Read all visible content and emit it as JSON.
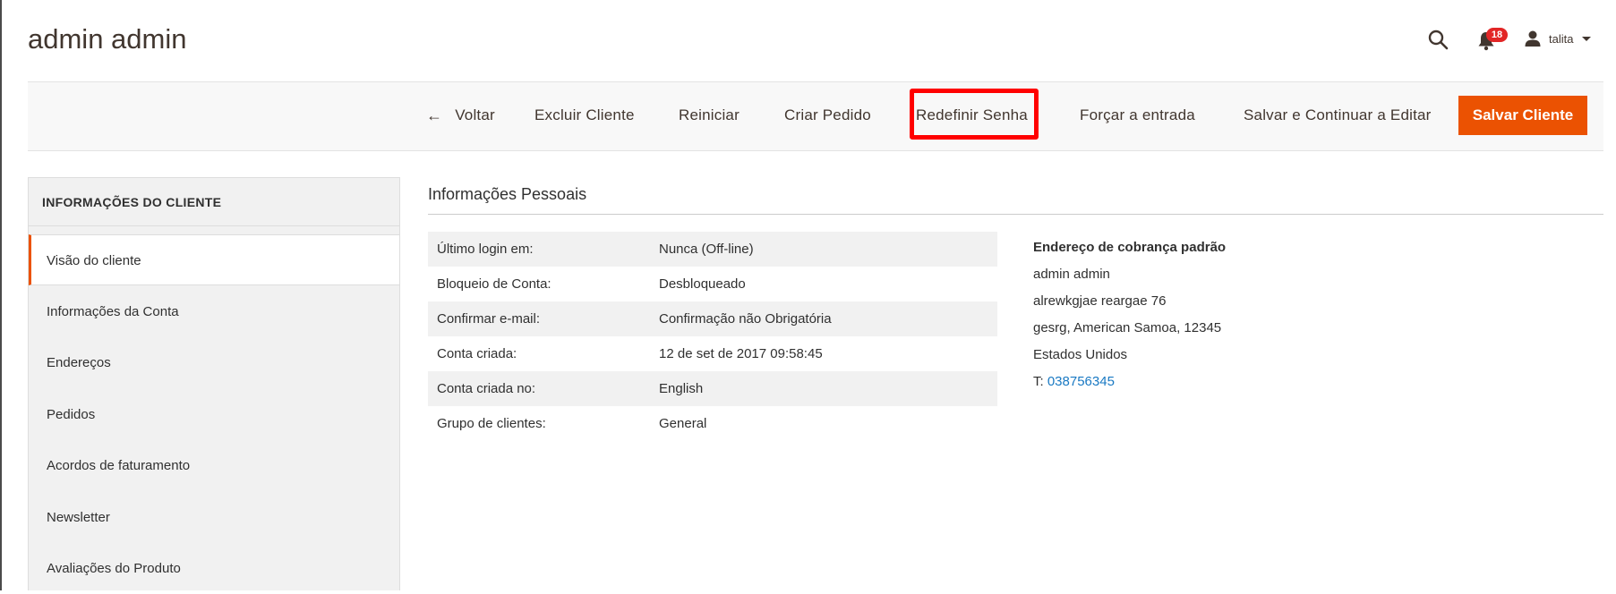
{
  "header": {
    "title": "admin admin",
    "notifications_count": "18",
    "user_name": "talita"
  },
  "toolbar": {
    "back_label": "Voltar",
    "back_arrow": "←",
    "delete_label": "Excluir Cliente",
    "reset_label": "Reiniciar",
    "create_order_label": "Criar Pedido",
    "reset_password_label": "Redefinir Senha",
    "login_as_label": "Forçar a entrada",
    "save_continue_label": "Salvar e Continuar a Editar",
    "save_label": "Salvar Cliente",
    "accent_color": "#eb5202",
    "highlight_color": "#ff0000"
  },
  "sidebar": {
    "title": "INFORMAÇÕES DO CLIENTE",
    "items": [
      {
        "label": "Visão do cliente",
        "active": true
      },
      {
        "label": "Informações da Conta"
      },
      {
        "label": "Endereços"
      },
      {
        "label": "Pedidos"
      },
      {
        "label": "Acordos de faturamento"
      },
      {
        "label": "Newsletter"
      },
      {
        "label": "Avaliações do Produto"
      }
    ]
  },
  "personal_info": {
    "title": "Informações Pessoais",
    "rows": [
      {
        "label": "Último login em:",
        "value": "Nunca (Off-line)"
      },
      {
        "label": "Bloqueio de Conta:",
        "value": "Desbloqueado"
      },
      {
        "label": "Confirmar e-mail:",
        "value": "Confirmação não Obrigatória"
      },
      {
        "label": "Conta criada:",
        "value": "12 de set de 2017 09:58:45"
      },
      {
        "label": "Conta criada no:",
        "value": "English"
      },
      {
        "label": "Grupo de clientes:",
        "value": "General"
      }
    ]
  },
  "billing_address": {
    "heading": "Endereço de cobrança padrão",
    "name": "admin admin",
    "street": "alrewkgjae reargae 76",
    "city_line": "gesrg, American Samoa, 12345",
    "country": "Estados Unidos",
    "phone_prefix": "T:",
    "phone": "038756345"
  }
}
